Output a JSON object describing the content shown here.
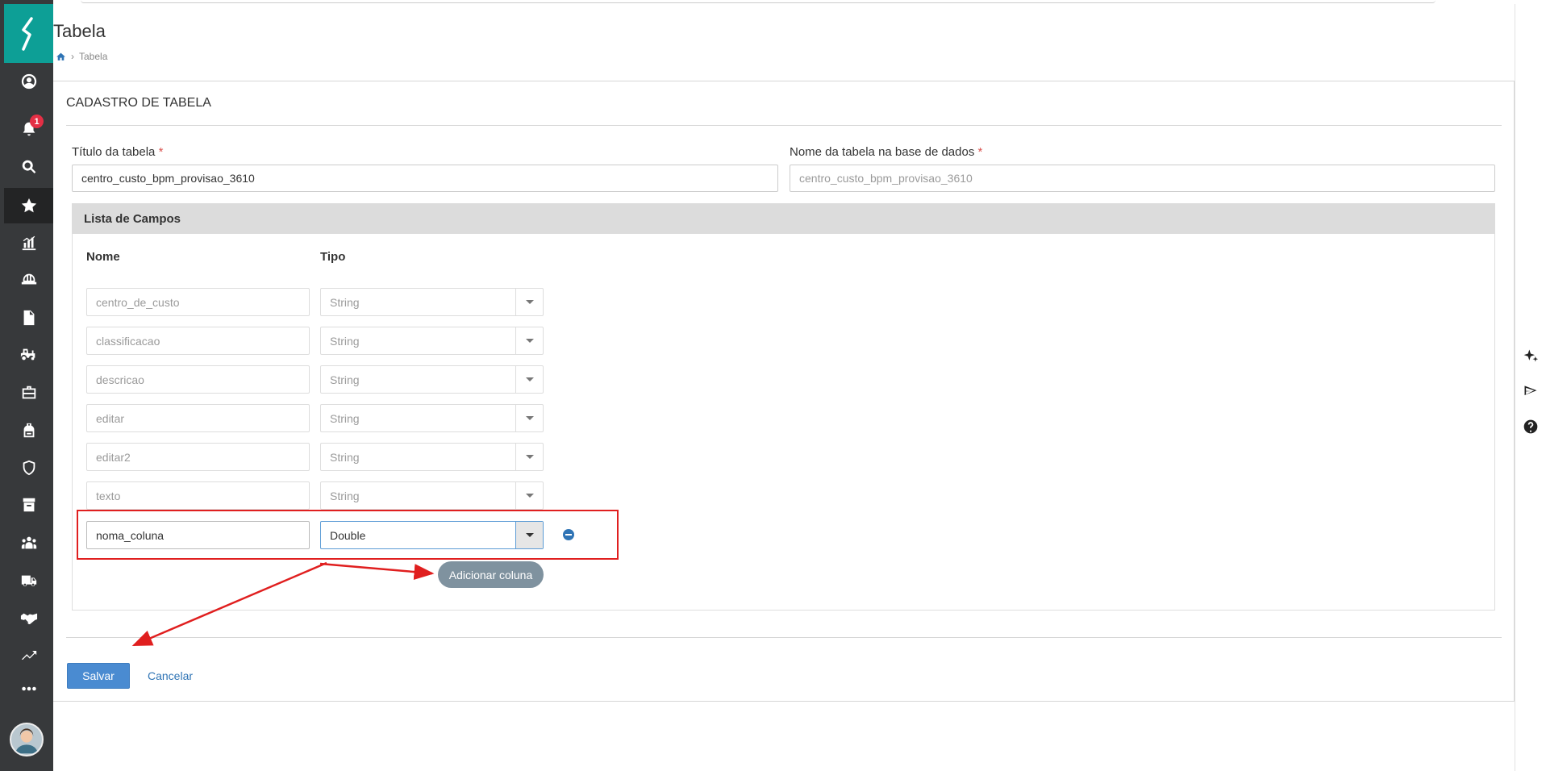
{
  "header": {
    "title": "Tabela",
    "breadcrumb_current": "Tabela"
  },
  "sidebar": {
    "notification_count": "1",
    "items": [
      "user-icon",
      "bell-icon",
      "search-icon",
      "star-icon",
      "chart-icon",
      "helmet-icon",
      "document-icon",
      "tractor-icon",
      "briefcase-icon",
      "backpack-icon",
      "shield-icon",
      "archive-icon",
      "team-icon",
      "truck-icon",
      "handshake-icon",
      "trend-icon",
      "more-icon"
    ]
  },
  "panel": {
    "title": "CADASTRO DE TABELA",
    "titulo_label": "Título da tabela",
    "titulo_value": "centro_custo_bpm_provisao_3610",
    "nome_label": "Nome da tabela na base de dados",
    "nome_placeholder": "centro_custo_bpm_provisao_3610",
    "required_mark": "*"
  },
  "lista": {
    "title": "Lista de Campos",
    "col_nome": "Nome",
    "col_tipo": "Tipo",
    "fields": [
      {
        "name": "centro_de_custo",
        "type": "String"
      },
      {
        "name": "classificacao",
        "type": "String"
      },
      {
        "name": "descricao",
        "type": "String"
      },
      {
        "name": "editar",
        "type": "String"
      },
      {
        "name": "editar2",
        "type": "String"
      },
      {
        "name": "texto",
        "type": "String"
      }
    ],
    "new_field": {
      "name": "noma_coluna",
      "type": "Double"
    },
    "add_button": "Adicionar coluna"
  },
  "actions": {
    "save": "Salvar",
    "cancel": "Cancelar"
  },
  "colors": {
    "sidebar": "#37393b",
    "logo": "#0d9f96",
    "primary": "#4a8bd1",
    "annotation": "#e01f1f"
  }
}
